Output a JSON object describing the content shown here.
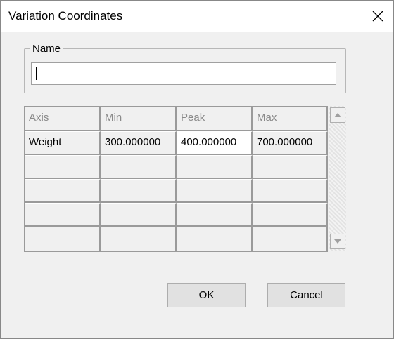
{
  "window": {
    "title": "Variation Coordinates",
    "close_icon": "close-icon"
  },
  "name_group": {
    "legend": "Name",
    "input_value": ""
  },
  "grid": {
    "headers": [
      "Axis",
      "Min",
      "Peak",
      "Max"
    ],
    "rows": [
      [
        "Weight",
        "300.000000",
        "400.000000",
        "700.000000"
      ],
      [
        "",
        "",
        "",
        ""
      ],
      [
        "",
        "",
        "",
        ""
      ],
      [
        "",
        "",
        "",
        ""
      ]
    ],
    "active_cell": "Peak",
    "scroll_up_icon": "scroll-up-arrow-icon",
    "scroll_down_icon": "scroll-down-arrow-icon"
  },
  "buttons": {
    "ok": "OK",
    "cancel": "Cancel"
  },
  "colors": {
    "dialog_bg": "#f0f0f0",
    "titlebar_bg": "#ffffff",
    "header_text": "#8a8a8a",
    "button_bg": "#e1e1e1"
  }
}
